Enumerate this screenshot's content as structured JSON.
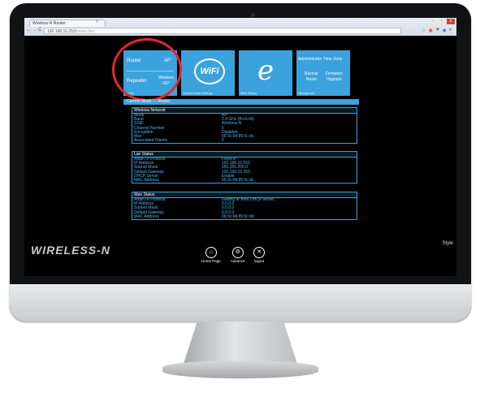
{
  "browser": {
    "tab_title": "Wireless-N Router",
    "tab_close": "×",
    "url_host": "192.168.10.253",
    "url_path": "/home.htm",
    "nav_back": "←",
    "nav_forward": "→",
    "nav_reload": "C",
    "window_min": "-",
    "window_max": "▫",
    "window_close": "x",
    "ext_icons": [
      "☆",
      "◉",
      "▼",
      "◆",
      "≡"
    ]
  },
  "tiles": {
    "mode": {
      "router": "Router",
      "ap": "AP",
      "repeater": "Repeater",
      "wireless_isp_line1": "Wireless",
      "wireless_isp_line2": "ISP",
      "caption": "Wizard"
    },
    "wifi": {
      "logo": "WiFi",
      "caption": "Wireless Basic Settings"
    },
    "ie": {
      "logo": "e",
      "caption": "WAN Setting"
    },
    "admin": {
      "header": "Administrator Time Zone",
      "l1a": "Backup",
      "l1b": "Reset",
      "l2a": "Firmware",
      "l2b": "Upgrade",
      "caption": "Management"
    }
  },
  "current_mode": "Current Mode --- Router",
  "wireless": {
    "title": "Wireless Network",
    "rows": [
      {
        "k": "Mode",
        "v": "AP"
      },
      {
        "k": "Band",
        "v": "2.4 GHz (B+G+N)"
      },
      {
        "k": "SSID",
        "v": "Wireless-N"
      },
      {
        "k": "Channel Number",
        "v": "5"
      },
      {
        "k": "Encryption",
        "v": "Disabled"
      },
      {
        "k": "Mac",
        "v": "00:3c:0d:85:5c:dc"
      },
      {
        "k": "Associated Clients",
        "v": "0"
      }
    ]
  },
  "lan": {
    "title": "Lan Status",
    "rows": [
      {
        "k": "Attain IP Protocol",
        "v": "Fixed IP"
      },
      {
        "k": "IP Address",
        "v": "192.168.10.253"
      },
      {
        "k": "Subnet Mask",
        "v": "255.255.255.0"
      },
      {
        "k": "Default Gateway",
        "v": "192.168.10.253"
      },
      {
        "k": "DHCP Server",
        "v": "Enable"
      },
      {
        "k": "MAC Address",
        "v": "00:3c:0d:85:5c:dc"
      }
    ]
  },
  "wan": {
    "title": "Wan Status",
    "rows": [
      {
        "k": "Attain IP Protocol",
        "v": "Getting IP from DHCP server..."
      },
      {
        "k": "IP Address",
        "v": "0.0.0.0"
      },
      {
        "k": "Subnet Mask",
        "v": "0.0.0.0"
      },
      {
        "k": "Default Gateway",
        "v": "0.0.0.0"
      },
      {
        "k": "MAC Address",
        "v": "00:3c:0d:85:5c:dd"
      }
    ]
  },
  "brand": "WIRELESS-N",
  "style_label": "Style",
  "bottom_nav": [
    {
      "icon": "⌂",
      "label": "Home Page"
    },
    {
      "icon": "⚙",
      "label": "Advance"
    },
    {
      "icon": "✕",
      "label": "logout"
    }
  ],
  "colors": {
    "tile_blue": "#3aa2dc",
    "highlight_red": "#e8262a",
    "value_blue": "#4fb6ee"
  }
}
